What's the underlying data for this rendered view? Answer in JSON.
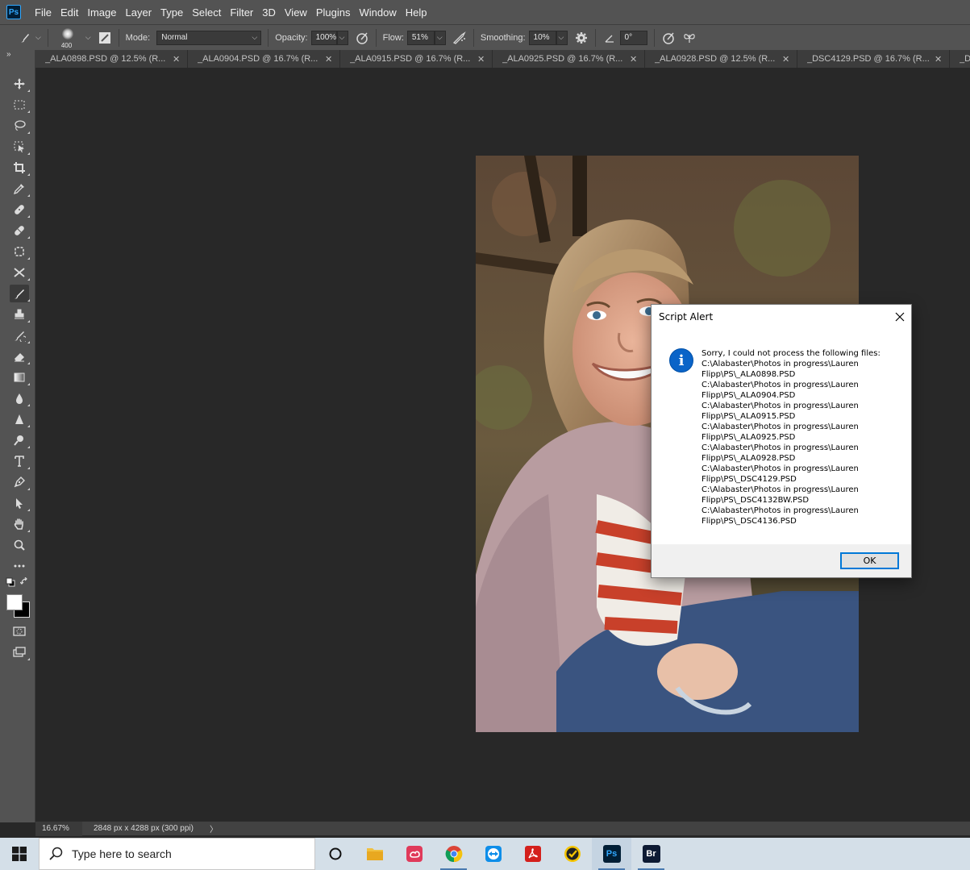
{
  "menu": [
    "File",
    "Edit",
    "Image",
    "Layer",
    "Type",
    "Select",
    "Filter",
    "3D",
    "View",
    "Plugins",
    "Window",
    "Help"
  ],
  "app_logo": "Ps",
  "options": {
    "brush_size": "400",
    "mode_label": "Mode:",
    "mode_value": "Normal",
    "opacity_label": "Opacity:",
    "opacity_value": "100%",
    "flow_label": "Flow:",
    "flow_value": "51%",
    "smoothing_label": "Smoothing:",
    "smoothing_value": "10%",
    "angle_value": "0°"
  },
  "toolbar_collapse": "»",
  "tabs": [
    "_ALA0898.PSD @ 12.5% (R...",
    "_ALA0904.PSD @ 16.7% (R...",
    "_ALA0915.PSD @ 16.7% (R...",
    "_ALA0925.PSD @ 16.7% (R...",
    "_ALA0928.PSD @ 12.5% (R...",
    "_DSC4129.PSD @ 16.7% (R...",
    "_D"
  ],
  "status": {
    "zoom": "16.67%",
    "doc_info": "2848 px x 4288 px (300 ppi)",
    "arrow": "〉"
  },
  "dialog": {
    "title": "Script Alert",
    "message_lines": [
      "Sorry, I could not process the following files:",
      "C:\\Alabaster\\Photos in progress\\Lauren",
      "Flipp\\PS\\_ALA0898.PSD",
      "C:\\Alabaster\\Photos in progress\\Lauren",
      "Flipp\\PS\\_ALA0904.PSD",
      "C:\\Alabaster\\Photos in progress\\Lauren",
      "Flipp\\PS\\_ALA0915.PSD",
      "C:\\Alabaster\\Photos in progress\\Lauren",
      "Flipp\\PS\\_ALA0925.PSD",
      "C:\\Alabaster\\Photos in progress\\Lauren",
      "Flipp\\PS\\_ALA0928.PSD",
      "C:\\Alabaster\\Photos in progress\\Lauren",
      "Flipp\\PS\\_DSC4129.PSD",
      "C:\\Alabaster\\Photos in progress\\Lauren",
      "Flipp\\PS\\_DSC4132BW.PSD",
      "C:\\Alabaster\\Photos in progress\\Lauren",
      "Flipp\\PS\\_DSC4136.PSD"
    ],
    "ok_label": "OK"
  },
  "taskbar": {
    "search_placeholder": "Type here to search",
    "ps_label": "Ps",
    "br_label": "Br"
  }
}
